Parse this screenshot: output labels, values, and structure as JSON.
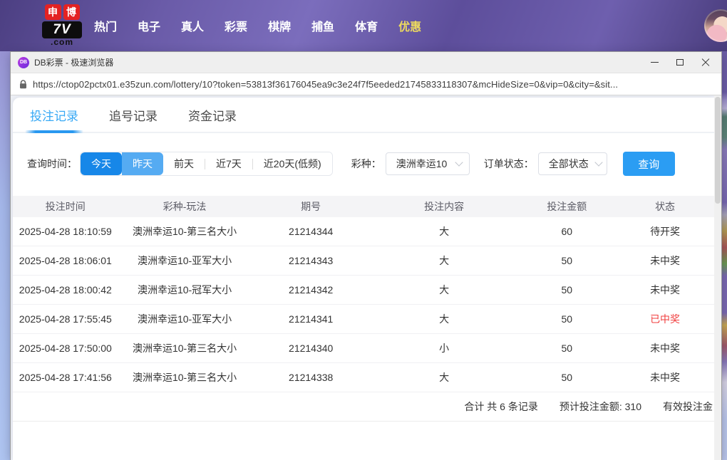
{
  "site_nav": {
    "logo": {
      "tile1": "申",
      "tile2": "博",
      "mid": "7V",
      "bottom": ".com"
    },
    "items": [
      {
        "label": "热门",
        "highlight": false
      },
      {
        "label": "电子",
        "highlight": false
      },
      {
        "label": "真人",
        "highlight": false
      },
      {
        "label": "彩票",
        "highlight": false
      },
      {
        "label": "棋牌",
        "highlight": false
      },
      {
        "label": "捕鱼",
        "highlight": false
      },
      {
        "label": "体育",
        "highlight": false
      },
      {
        "label": "优惠",
        "highlight": true
      }
    ]
  },
  "browser": {
    "title": "DB彩票 - 极速浏览器",
    "favicon_text": "DB",
    "url": "https://ctop02pctx01.e35zun.com/lottery/10?token=53813f36176045ea9c3e24f7f5eeded21745833118307&mcHideSize=0&vip=0&city=&sit..."
  },
  "tabs": [
    {
      "label": "投注记录",
      "active": true
    },
    {
      "label": "追号记录",
      "active": false
    },
    {
      "label": "资金记录",
      "active": false
    }
  ],
  "filters": {
    "time_label": "查询时间：",
    "time_options": [
      {
        "label": "今天",
        "style": "primary",
        "sep_before": false
      },
      {
        "label": "昨天",
        "style": "secondary",
        "sep_before": false
      },
      {
        "label": "前天",
        "style": "plain",
        "sep_before": false
      },
      {
        "label": "近7天",
        "style": "plain",
        "sep_before": true
      },
      {
        "label": "近20天(低频)",
        "style": "plain",
        "sep_before": true
      }
    ],
    "lottery_label": "彩种：",
    "lottery_value": "澳洲幸运10",
    "status_label": "订单状态：",
    "status_value": "全部状态",
    "query_label": "查询"
  },
  "table": {
    "columns": [
      "投注时间",
      "彩种-玩法",
      "期号",
      "投注内容",
      "投注金额",
      "状态"
    ],
    "rows": [
      {
        "time": "2025-04-28 18:10:59",
        "game": "澳洲幸运10-第三名大小",
        "issue": "21214344",
        "content": "大",
        "amount": "60",
        "status": "待开奖",
        "status_color": "#333333"
      },
      {
        "time": "2025-04-28 18:06:01",
        "game": "澳洲幸运10-亚军大小",
        "issue": "21214343",
        "content": "大",
        "amount": "50",
        "status": "未中奖",
        "status_color": "#333333"
      },
      {
        "time": "2025-04-28 18:00:42",
        "game": "澳洲幸运10-冠军大小",
        "issue": "21214342",
        "content": "大",
        "amount": "50",
        "status": "未中奖",
        "status_color": "#333333"
      },
      {
        "time": "2025-04-28 17:55:45",
        "game": "澳洲幸运10-亚军大小",
        "issue": "21214341",
        "content": "大",
        "amount": "50",
        "status": "已中奖",
        "status_color": "#f03e3e"
      },
      {
        "time": "2025-04-28 17:50:00",
        "game": "澳洲幸运10-第三名大小",
        "issue": "21214340",
        "content": "小",
        "amount": "50",
        "status": "未中奖",
        "status_color": "#333333"
      },
      {
        "time": "2025-04-28 17:41:56",
        "game": "澳洲幸运10-第三名大小",
        "issue": "21214338",
        "content": "大",
        "amount": "50",
        "status": "未中奖",
        "status_color": "#333333"
      }
    ],
    "summary": {
      "total": "合计 共 6 条记录",
      "expected": "预计投注金额: 310",
      "valid": "有效投注金"
    }
  },
  "colors": {
    "accent_blue": "#2b9df3",
    "tab_active": "#38a9f5",
    "time_today_bg": "#1787e8",
    "time_yesterday_bg": "#55abf2",
    "win_status_red": "#f03e3e",
    "nav_highlight": "#ecd95f",
    "navbar_purple": "#6a5ba8"
  }
}
